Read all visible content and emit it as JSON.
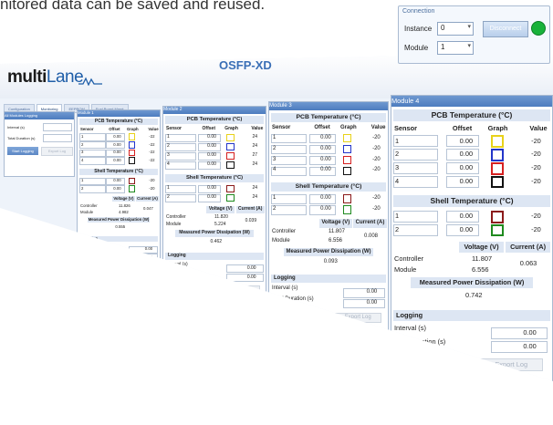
{
  "caption": "nitored data can be saved and reused.",
  "app": {
    "title": "OSFP-XD",
    "logo_multi": "multi",
    "logo_lane": "Lane"
  },
  "connection": {
    "title": "Connection",
    "instance_label": "Instance",
    "instance_value": "0",
    "module_label": "Module",
    "module_value": "1",
    "disconnect_label": "Disconnect",
    "status_color": "#19b23a"
  },
  "tabs": [
    "Configuration",
    "Monitoring",
    "EEPROM",
    "Eval Board Mgmt"
  ],
  "log_panel": {
    "title": "All Modules Logging",
    "interval_label": "Interval (s)",
    "duration_label": "Total Duration (s)",
    "start_label": "Start Logging",
    "export_label": "Export Log"
  },
  "modules": [
    {
      "title": "Module 1",
      "pcb_title": "PCB Temperature (°C)",
      "cols": [
        "Sensor",
        "Offset",
        "Graph",
        "Value"
      ],
      "pcb": [
        {
          "sensor": "1",
          "offset": "0.00",
          "value": "-22",
          "color": "#e8d21a"
        },
        {
          "sensor": "2",
          "offset": "0.00",
          "value": "-22",
          "color": "#2235c9"
        },
        {
          "sensor": "3",
          "offset": "0.00",
          "value": "-22",
          "color": "#d62020"
        },
        {
          "sensor": "4",
          "offset": "0.00",
          "value": "-22",
          "color": "#111111"
        }
      ],
      "shell_title": "Shell Temperature (°C)",
      "shell": [
        {
          "sensor": "1",
          "offset": "0.00",
          "value": "-20",
          "color": "#8b1a1a"
        },
        {
          "sensor": "2",
          "offset": "0.00",
          "value": "-20",
          "color": "#1e8a1e"
        }
      ],
      "vhead": "Voltage (V)",
      "chead": "Current (A)",
      "controller_label": "Controller",
      "controller_v": "11.826",
      "module_label": "Module",
      "module_v": "4.982",
      "current": "0.047",
      "power_title": "Measured Power Dissipation (W)",
      "power": "0.555",
      "logging_title": "Logging",
      "interval_label": "Interval (s)",
      "interval": "0.00",
      "duration_label": "Total Duration (s)",
      "duration": "0.00",
      "start_label": "Start Logging",
      "export_label": "Export Log"
    },
    {
      "title": "Module 2",
      "pcb_title": "PCB Temperature (°C)",
      "cols": [
        "Sensor",
        "Offset",
        "Graph",
        "Value"
      ],
      "pcb": [
        {
          "sensor": "1",
          "offset": "0.00",
          "value": "24",
          "color": "#e8d21a"
        },
        {
          "sensor": "2",
          "offset": "0.00",
          "value": "24",
          "color": "#2235c9"
        },
        {
          "sensor": "3",
          "offset": "0.00",
          "value": "27",
          "color": "#d62020"
        },
        {
          "sensor": "4",
          "offset": "0.00",
          "value": "24",
          "color": "#111111"
        }
      ],
      "shell_title": "Shell Temperature (°C)",
      "shell": [
        {
          "sensor": "1",
          "offset": "0.00",
          "value": "24",
          "color": "#8b1a1a"
        },
        {
          "sensor": "2",
          "offset": "0.00",
          "value": "24",
          "color": "#1e8a1e"
        }
      ],
      "vhead": "Voltage (V)",
      "chead": "Current (A)",
      "controller_label": "Controller",
      "controller_v": "11.820",
      "module_label": "Module",
      "module_v": "5.224",
      "current": "0.039",
      "power_title": "Measured Power Dissipation (W)",
      "power": "0.462",
      "logging_title": "Logging",
      "interval_label": "Interval (s)",
      "interval": "0.00",
      "duration_label": "Total Duration (s)",
      "duration": "0.00",
      "start_label": "Start Logging",
      "export_label": "Export Log"
    },
    {
      "title": "Module 3",
      "pcb_title": "PCB Temperature (°C)",
      "cols": [
        "Sensor",
        "Offset",
        "Graph",
        "Value"
      ],
      "pcb": [
        {
          "sensor": "1",
          "offset": "0.00",
          "value": "-20",
          "color": "#e8d21a"
        },
        {
          "sensor": "2",
          "offset": "0.00",
          "value": "-20",
          "color": "#2235c9"
        },
        {
          "sensor": "3",
          "offset": "0.00",
          "value": "-20",
          "color": "#d62020"
        },
        {
          "sensor": "4",
          "offset": "0.00",
          "value": "-20",
          "color": "#111111"
        }
      ],
      "shell_title": "Shell Temperature (°C)",
      "shell": [
        {
          "sensor": "1",
          "offset": "0.00",
          "value": "-20",
          "color": "#8b1a1a"
        },
        {
          "sensor": "2",
          "offset": "0.00",
          "value": "-20",
          "color": "#1e8a1e"
        }
      ],
      "vhead": "Voltage (V)",
      "chead": "Current (A)",
      "controller_label": "Controller",
      "controller_v": "11.807",
      "module_label": "Module",
      "module_v": "6.556",
      "current": "0.008",
      "power_title": "Measured Power Dissipation (W)",
      "power": "0.093",
      "logging_title": "Logging",
      "interval_label": "Interval (s)",
      "interval": "0.00",
      "duration_label": "Total Duration (s)",
      "duration": "0.00",
      "start_label": "Start Logging",
      "export_label": "Export Log"
    },
    {
      "title": "Module 4",
      "pcb_title": "PCB Temperature (°C)",
      "cols": [
        "Sensor",
        "Offset",
        "Graph",
        "Value"
      ],
      "pcb": [
        {
          "sensor": "1",
          "offset": "0.00",
          "value": "-20",
          "color": "#e8d21a"
        },
        {
          "sensor": "2",
          "offset": "0.00",
          "value": "-20",
          "color": "#2235c9"
        },
        {
          "sensor": "3",
          "offset": "0.00",
          "value": "-20",
          "color": "#d62020"
        },
        {
          "sensor": "4",
          "offset": "0.00",
          "value": "-20",
          "color": "#111111"
        }
      ],
      "shell_title": "Shell Temperature (°C)",
      "shell": [
        {
          "sensor": "1",
          "offset": "0.00",
          "value": "-20",
          "color": "#8b1a1a"
        },
        {
          "sensor": "2",
          "offset": "0.00",
          "value": "-20",
          "color": "#1e8a1e"
        }
      ],
      "vhead": "Voltage (V)",
      "chead": "Current (A)",
      "controller_label": "Controller",
      "controller_v": "11.807",
      "module_label": "Module",
      "module_v": "6.556",
      "current": "0.063",
      "power_title": "Measured Power Dissipation (W)",
      "power": "0.742",
      "logging_title": "Logging",
      "interval_label": "Interval (s)",
      "interval": "0.00",
      "duration_label": "Total Duration (s)",
      "duration": "0.00",
      "start_label": "Start Logging",
      "export_label": "Export Log"
    }
  ]
}
